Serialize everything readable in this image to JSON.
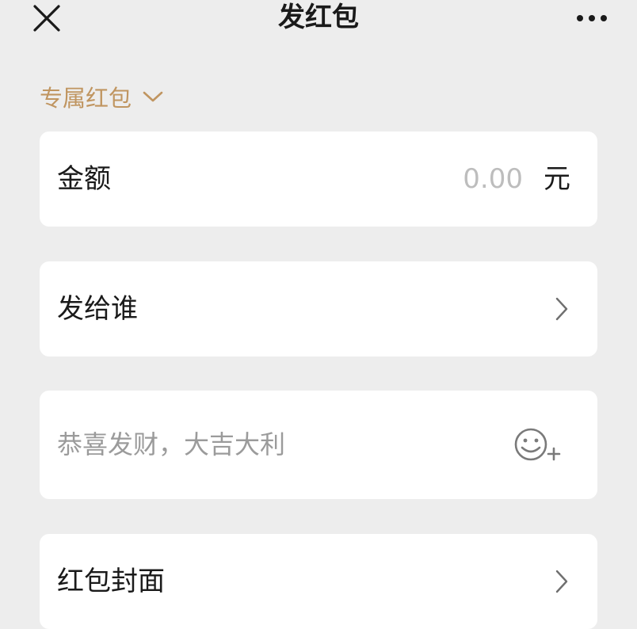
{
  "header": {
    "title": "发红包",
    "close_icon": "close-icon",
    "more_icon": "more-icon"
  },
  "packet_type": {
    "label": "专属红包",
    "icon": "chevron-down-icon",
    "color": "#c09560"
  },
  "amount": {
    "label": "金额",
    "value": "0.00",
    "unit": "元"
  },
  "recipient": {
    "label": "发给谁",
    "icon": "chevron-right-icon"
  },
  "greeting": {
    "placeholder": "恭喜发财，大吉大利",
    "icon": "emoji-add-icon"
  },
  "cover": {
    "label": "红包封面",
    "icon": "chevron-right-icon"
  }
}
